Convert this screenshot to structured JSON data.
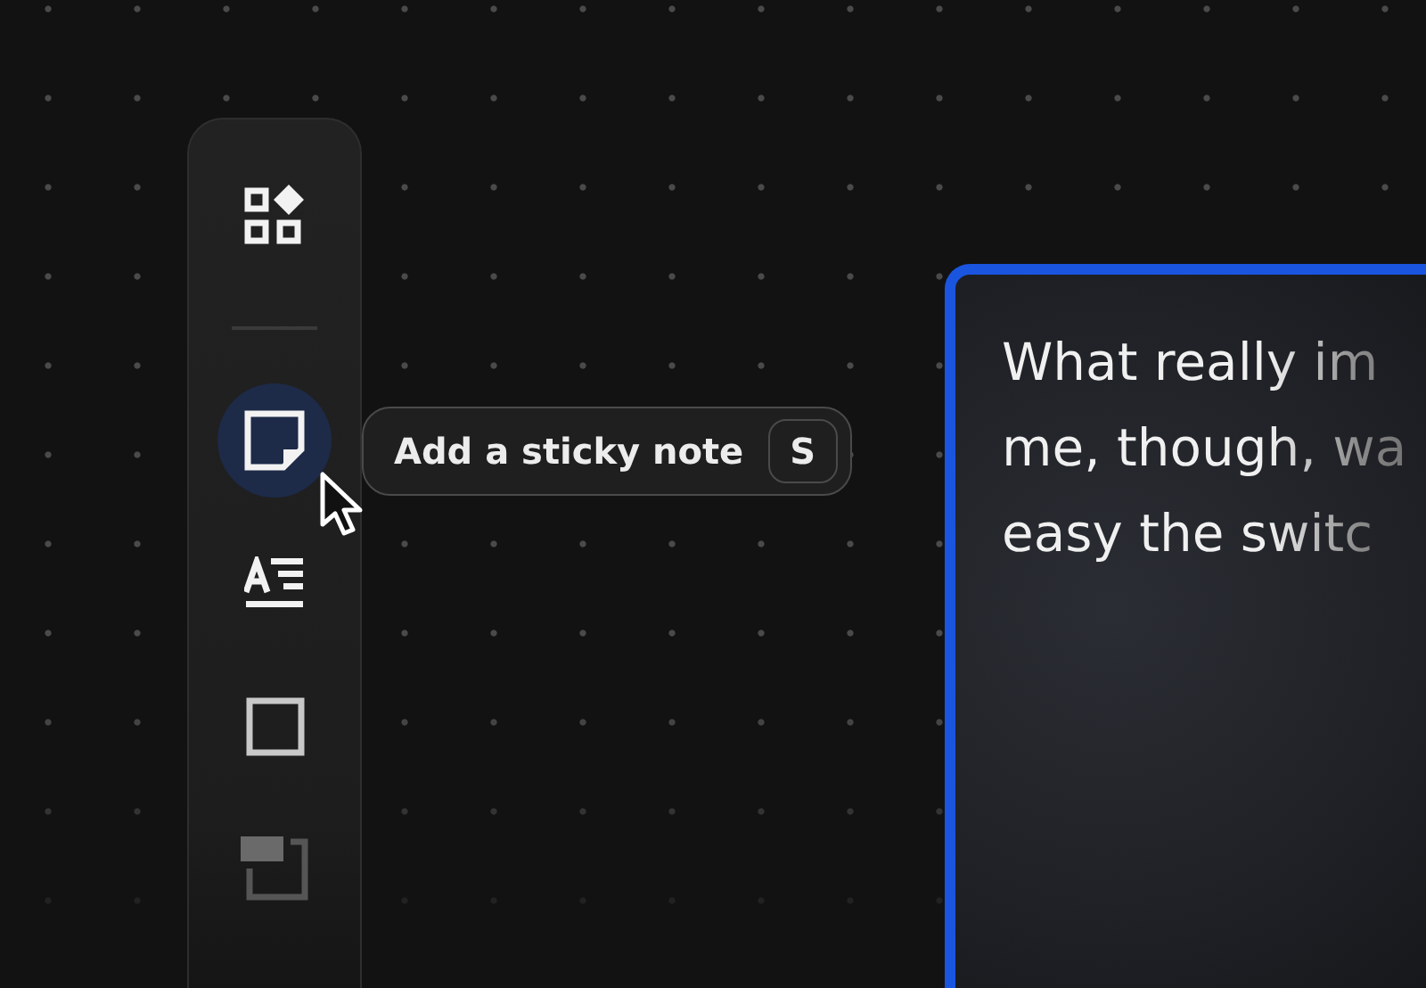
{
  "toolbar": {
    "tools": [
      {
        "kind": "components",
        "selected": false
      },
      {
        "kind": "divider"
      },
      {
        "kind": "sticky-note",
        "selected": true
      },
      {
        "kind": "text",
        "selected": false
      },
      {
        "kind": "shape",
        "selected": false
      },
      {
        "kind": "section",
        "selected": false
      }
    ]
  },
  "tooltip": {
    "label": "Add a sticky note",
    "shortcut": "S"
  },
  "card": {
    "lines": [
      "What really im",
      "me, though, wa",
      "easy the switc"
    ]
  }
}
